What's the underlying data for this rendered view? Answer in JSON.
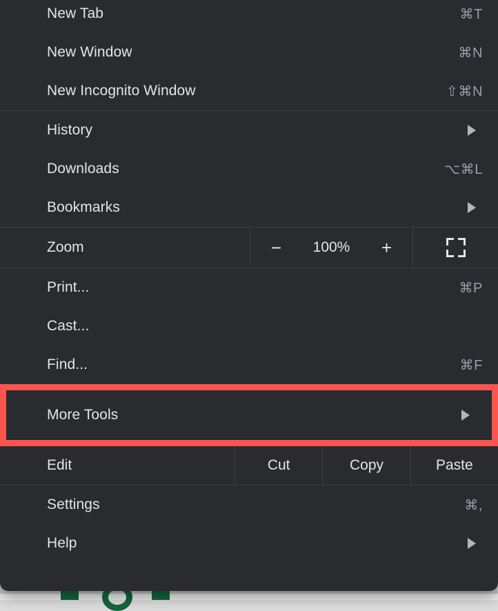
{
  "menu": {
    "groups": [
      {
        "id": "new",
        "items": [
          {
            "label": "New Tab",
            "shortcut": "⌘T",
            "arrow": false
          },
          {
            "label": "New Window",
            "shortcut": "⌘N",
            "arrow": false
          },
          {
            "label": "New Incognito Window",
            "shortcut": "⇧⌘N",
            "arrow": false
          }
        ]
      },
      {
        "id": "browsing",
        "items": [
          {
            "label": "History",
            "shortcut": "",
            "arrow": true
          },
          {
            "label": "Downloads",
            "shortcut": "⌥⌘L",
            "arrow": false
          },
          {
            "label": "Bookmarks",
            "shortcut": "",
            "arrow": true
          }
        ]
      },
      {
        "id": "page",
        "items": [
          {
            "label": "Print...",
            "shortcut": "⌘P",
            "arrow": false
          },
          {
            "label": "Cast...",
            "shortcut": "",
            "arrow": false
          },
          {
            "label": "Find...",
            "shortcut": "⌘F",
            "arrow": false
          }
        ]
      },
      {
        "id": "bottom",
        "items": [
          {
            "label": "Settings",
            "shortcut": "⌘,",
            "arrow": false
          },
          {
            "label": "Help",
            "shortcut": "",
            "arrow": true
          }
        ]
      }
    ],
    "zoom": {
      "label": "Zoom",
      "decrease_label": "−",
      "value": "100%",
      "increase_label": "+",
      "fullscreen_icon": "fullscreen-icon"
    },
    "more_tools": {
      "label": "More Tools",
      "arrow_icon": "chevron-right-icon",
      "highlighted": true,
      "highlight_color": "#f9554e"
    },
    "edit": {
      "label": "Edit",
      "actions": [
        "Cut",
        "Copy",
        "Paste"
      ]
    },
    "colors": {
      "background": "#292b2e",
      "divider": "#3b3e42",
      "text": "#e4e5e6",
      "shortcut_text": "#9aa0a6",
      "highlight": "#f9554e"
    }
  },
  "backdrop": {
    "page_background": "#e9e9e9",
    "logo_color": "#14663c"
  }
}
